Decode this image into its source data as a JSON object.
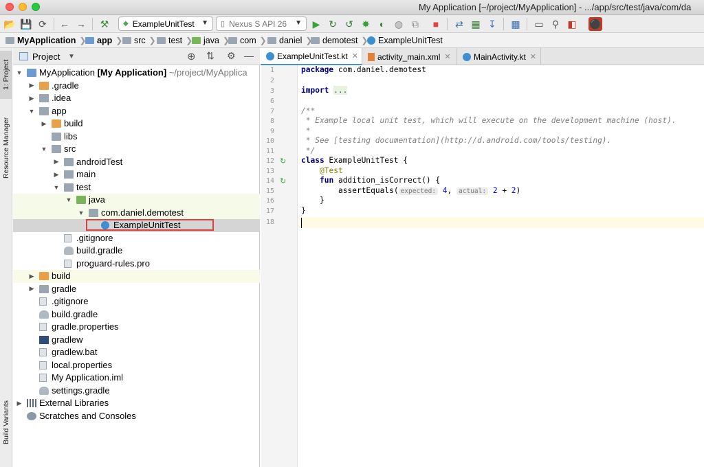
{
  "window": {
    "title": "My Application [~/project/MyApplication] - .../app/src/test/java/com/da"
  },
  "toolbar": {
    "run_config": "ExampleUnitTest",
    "device": "Nexus S API 26"
  },
  "breadcrumbs": [
    {
      "label": "MyApplication",
      "bold": true
    },
    {
      "label": "app",
      "bold": true
    },
    {
      "label": "src"
    },
    {
      "label": "test"
    },
    {
      "label": "java"
    },
    {
      "label": "com"
    },
    {
      "label": "daniel"
    },
    {
      "label": "demotest"
    },
    {
      "label": "ExampleUnitTest"
    }
  ],
  "side_tabs": {
    "project": "1: Project",
    "resource_manager": "Resource Manager",
    "build_variants": "Build Variants"
  },
  "project_panel": {
    "view_label": "Project",
    "root": {
      "name": "MyApplication",
      "module": "[My Application]",
      "path": "~/project/MyApplica"
    },
    "items": [
      {
        "label": ".gradle"
      },
      {
        "label": ".idea"
      },
      {
        "label": "app"
      },
      {
        "label": "build"
      },
      {
        "label": "libs"
      },
      {
        "label": "src"
      },
      {
        "label": "androidTest"
      },
      {
        "label": "main"
      },
      {
        "label": "test"
      },
      {
        "label": "java"
      },
      {
        "label": "com.daniel.demotest"
      },
      {
        "label": "ExampleUnitTest"
      },
      {
        "label": ".gitignore"
      },
      {
        "label": "build.gradle"
      },
      {
        "label": "proguard-rules.pro"
      },
      {
        "label": "build"
      },
      {
        "label": "gradle"
      },
      {
        "label": ".gitignore"
      },
      {
        "label": "build.gradle"
      },
      {
        "label": "gradle.properties"
      },
      {
        "label": "gradlew"
      },
      {
        "label": "gradlew.bat"
      },
      {
        "label": "local.properties"
      },
      {
        "label": "My Application.iml"
      },
      {
        "label": "settings.gradle"
      },
      {
        "label": "External Libraries"
      },
      {
        "label": "Scratches and Consoles"
      }
    ]
  },
  "editor": {
    "tabs": [
      {
        "label": "ExampleUnitTest.kt"
      },
      {
        "label": "activity_main.xml"
      },
      {
        "label": "MainActivity.kt"
      }
    ],
    "line_numbers": [
      "1",
      "2",
      "3",
      "6",
      "7",
      "8",
      "9",
      "10",
      "11",
      "12",
      "13",
      "14",
      "15",
      "16",
      "17",
      "18"
    ],
    "code": {
      "kw_package": "package",
      "package_name": "com.daniel.demotest",
      "kw_import": "import",
      "import_fold": "...",
      "doc_open": "/**",
      "doc_1": " * Example local unit test, which will execute on the development machine (host).",
      "doc_2": " *",
      "doc_3": " * See [testing documentation](http://d.android.com/tools/testing).",
      "doc_close": " */",
      "kw_class": "class",
      "class_rest": " ExampleUnitTest {",
      "annotation": "@Test",
      "kw_fun": "fun",
      "fun_rest": " addition_isCorrect() {",
      "assert_call": "assertEquals(",
      "hint_expected": "expected:",
      "num_4": "4",
      "comma": ", ",
      "hint_actual": "actual:",
      "num_2a": "2",
      "plus": " + ",
      "num_2b": "2",
      "close_paren": ")",
      "brace_inner": "}",
      "brace_outer": "}"
    }
  },
  "colors": {
    "selection_highlight": "#d5d5d5",
    "test_root_bg": "#f5fbe8",
    "red_box": "#e0403a",
    "current_line": "#fffae3"
  }
}
